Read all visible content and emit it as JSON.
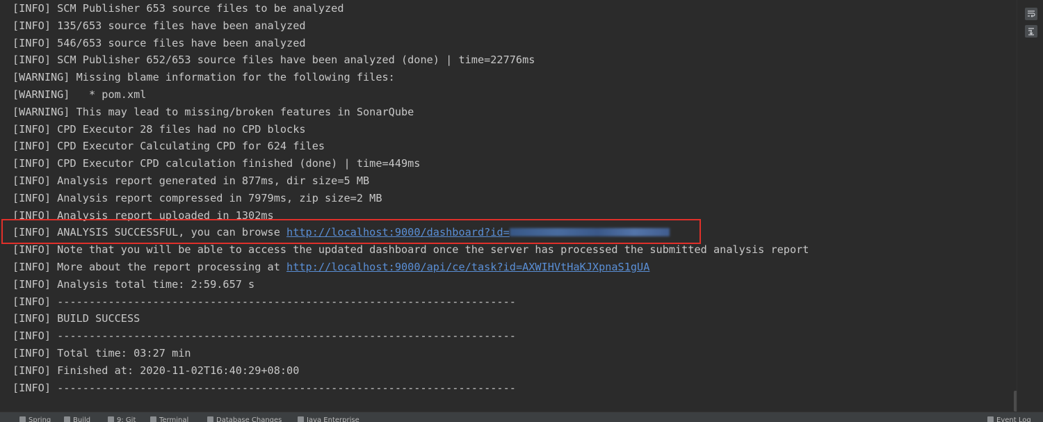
{
  "console": {
    "lines": [
      {
        "text": "[INFO] SCM Publisher 653 source files to be analyzed"
      },
      {
        "text": "[INFO] 135/653 source files have been analyzed"
      },
      {
        "text": "[INFO] 546/653 source files have been analyzed"
      },
      {
        "text": "[INFO] SCM Publisher 652/653 source files have been analyzed (done) | time=22776ms"
      },
      {
        "text": "[WARNING] Missing blame information for the following files:"
      },
      {
        "text": "[WARNING]   * pom.xml"
      },
      {
        "text": "[WARNING] This may lead to missing/broken features in SonarQube"
      },
      {
        "text": "[INFO] CPD Executor 28 files had no CPD blocks"
      },
      {
        "text": "[INFO] CPD Executor Calculating CPD for 624 files"
      },
      {
        "text": "[INFO] CPD Executor CPD calculation finished (done) | time=449ms"
      },
      {
        "text": "[INFO] Analysis report generated in 877ms, dir size=5 MB"
      },
      {
        "text": "[INFO] Analysis report compressed in 7979ms, zip size=2 MB"
      },
      {
        "text": "[INFO] Analysis report uploaded in 1302ms"
      },
      {
        "text": "[INFO] ANALYSIS SUCCESSFUL, you can browse ",
        "link": "http://localhost:9000/dashboard?id=",
        "redacted": true
      },
      {
        "text": "[INFO] Note that you will be able to access the updated dashboard once the server has processed the submitted analysis report"
      },
      {
        "text": "[INFO] More about the report processing at ",
        "link": "http://localhost:9000/api/ce/task?id=AXWIHVtHaKJXpnaS1gUA"
      },
      {
        "text": "[INFO] Analysis total time: 2:59.657 s"
      },
      {
        "text": "[INFO] ------------------------------------------------------------------------"
      },
      {
        "text": "[INFO] BUILD SUCCESS"
      },
      {
        "text": "[INFO] ------------------------------------------------------------------------"
      },
      {
        "text": "[INFO] Total time: 03:27 min"
      },
      {
        "text": "[INFO] Finished at: 2020-11-02T16:40:29+08:00"
      },
      {
        "text": "[INFO] ------------------------------------------------------------------------"
      }
    ]
  },
  "gutter": {
    "wrap_icon": "soft-wrap-icon",
    "scroll_icon": "scroll-to-end-icon"
  },
  "statusbar": {
    "items": [
      {
        "label": "Spring",
        "icon": "spring-icon"
      },
      {
        "label": "Build",
        "icon": "build-icon"
      },
      {
        "label": "9: Git",
        "icon": "git-icon"
      },
      {
        "label": "Terminal",
        "icon": "terminal-icon"
      },
      {
        "label": "Database Changes",
        "icon": "database-icon"
      },
      {
        "label": "Java Enterprise",
        "icon": "java-enterprise-icon"
      },
      {
        "label": "Event Log",
        "icon": "event-log-icon"
      }
    ]
  },
  "colors": {
    "background": "#2b2b2b",
    "text": "#c8c8c8",
    "link": "#5a8fd6",
    "highlight": "#e0302a"
  }
}
